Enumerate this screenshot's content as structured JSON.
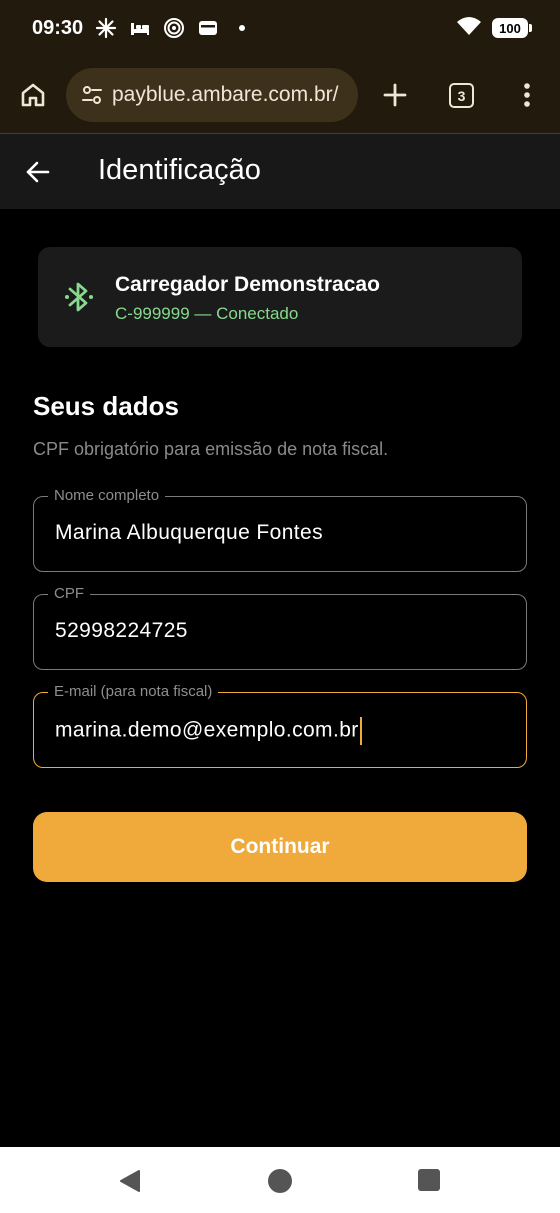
{
  "status_bar": {
    "time": "09:30",
    "battery": "100",
    "icons": [
      "spark-icon",
      "bed-icon",
      "target-icon",
      "wallet-icon",
      "dot-icon"
    ]
  },
  "browser": {
    "url": "payblue.ambare.com.br/",
    "tab_count": "3"
  },
  "app_bar": {
    "title": "Identificação"
  },
  "charger": {
    "name": "Carregador Demonstracao",
    "status": "C-999999 — Conectado",
    "status_color": "#86d98e"
  },
  "form": {
    "title": "Seus dados",
    "subtitle": "CPF obrigatório para emissão de nota fiscal.",
    "fields": [
      {
        "label": "Nome completo",
        "value": "Marina Albuquerque Fontes"
      },
      {
        "label": "CPF",
        "value": "52998224725"
      },
      {
        "label": "E-mail (para nota fiscal)",
        "value": "marina.demo@exemplo.com.br"
      }
    ],
    "submit_label": "Continuar"
  },
  "colors": {
    "accent": "#f0a93b",
    "browser_bg": "#221a0c",
    "app_bar_bg": "#181818"
  }
}
